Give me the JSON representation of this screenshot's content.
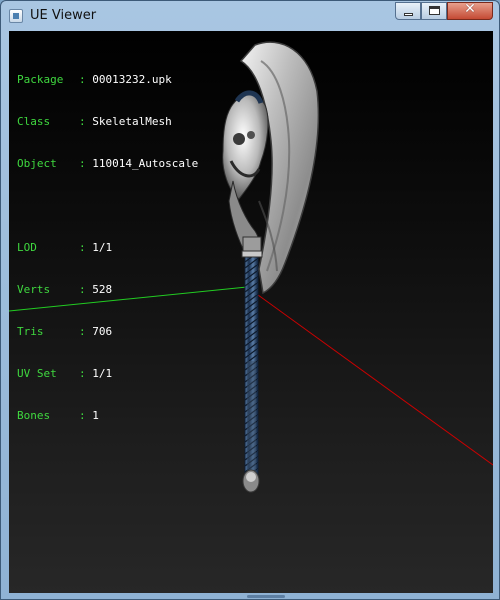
{
  "window": {
    "title": "UE Viewer",
    "controls": {
      "minimize": "minimize",
      "maximize": "maximize",
      "close": "✕"
    }
  },
  "info": {
    "package": {
      "key": "Package",
      "value": "00013232.upk"
    },
    "class": {
      "key": "Class",
      "value": "SkeletalMesh"
    },
    "object": {
      "key": "Object",
      "value": "110014_Autoscale"
    },
    "lod": {
      "key": "LOD",
      "value": "1/1"
    },
    "verts": {
      "key": "Verts",
      "value": "528"
    },
    "tris": {
      "key": "Tris",
      "value": "706"
    },
    "uvset": {
      "key": "UV Set",
      "value": "1/1"
    },
    "bones": {
      "key": "Bones",
      "value": "1"
    }
  },
  "colors": {
    "info_key": "#3fd83f",
    "axis_x": "#cc0000",
    "axis_y": "#22cc22",
    "axis_z": "#2244ff"
  },
  "icons": {
    "app": "ue-viewer-app-icon"
  }
}
